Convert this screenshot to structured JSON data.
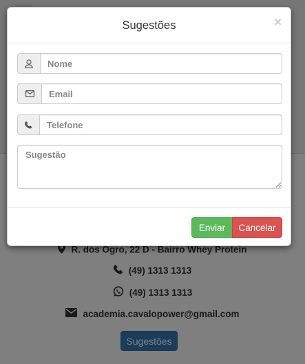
{
  "modal": {
    "title": "Sugestões",
    "close_symbol": "×",
    "fields": {
      "nome_placeholder": "Nome",
      "email_placeholder": "Email",
      "telefone_placeholder": "Telefone",
      "sugestao_placeholder": "Sugestão"
    },
    "icons": {
      "nome": "user-icon",
      "email": "envelope-icon",
      "telefone": "phone-icon"
    },
    "buttons": {
      "submit_label": "Enviar",
      "cancel_label": "Cancelar"
    }
  },
  "background": {
    "address": "R. dos Ogro, 22 D - Bairro Whey Protein",
    "phone": "(49) 1313 1313",
    "whatsapp": "(49) 1313 1313",
    "email": "academia.cavalopower@gmail.com",
    "button_label": "Sugestões",
    "icons": [
      "map-marker-icon",
      "phone-icon",
      "whatsapp-icon",
      "envelope-icon"
    ]
  },
  "colors": {
    "success": "#5cb85c",
    "danger": "#d9534f",
    "primary": "#337ab7",
    "backdrop": "#000000"
  }
}
